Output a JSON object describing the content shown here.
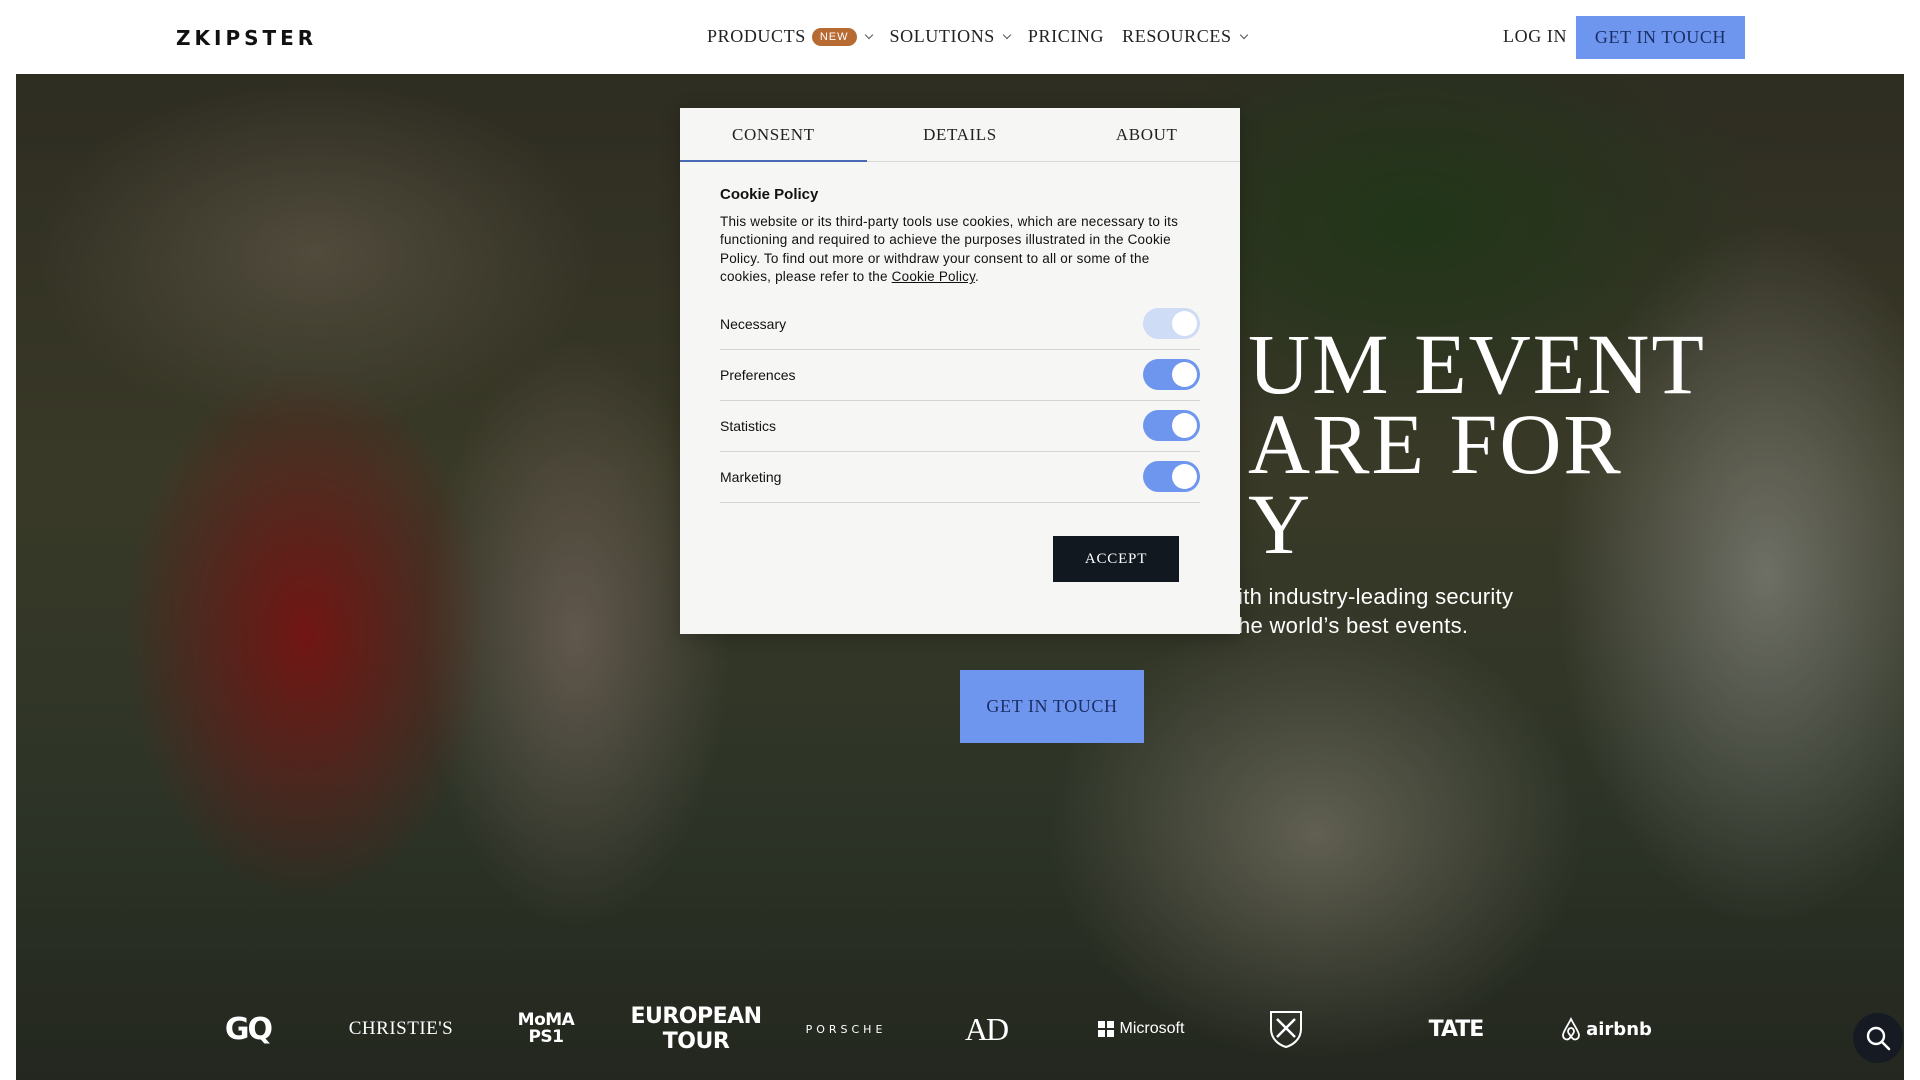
{
  "header": {
    "logo": "ZKIPSTER",
    "nav": [
      {
        "label": "PRODUCTS",
        "badge": "NEW",
        "dropdown": true
      },
      {
        "label": "SOLUTIONS",
        "dropdown": true
      },
      {
        "label": "PRICING",
        "dropdown": false
      },
      {
        "label": "RESOURCES",
        "dropdown": true
      }
    ],
    "login": "LOG IN",
    "cta": "GET IN TOUCH"
  },
  "hero": {
    "headline_lines": [
      "UM EVENT",
      "ARE FOR",
      "Y"
    ],
    "subline_lines": [
      "ith industry-leading security",
      "he world’s best events."
    ],
    "cta": "GET IN TOUCH",
    "brand_logos": [
      "GQ",
      "CHRISTIE'S",
      "MoMA PS1",
      "EUROPEAN TOUR",
      "PORSCHE",
      "AD",
      "Microsoft",
      "crest",
      "TATE",
      "airbnb"
    ]
  },
  "cookie_dialog": {
    "tabs": [
      "CONSENT",
      "DETAILS",
      "ABOUT"
    ],
    "active_tab": "CONSENT",
    "title": "Cookie Policy",
    "text": "This website or its third-party tools use cookies, which are necessary to its functioning and required to achieve the purposes illustrated in the Cookie Policy. To find out more or withdraw your consent to all or some of the cookies, please refer to the ",
    "link": "Cookie Policy",
    "text_end": ".",
    "toggles": [
      {
        "label": "Necessary",
        "enabled": true,
        "locked": true
      },
      {
        "label": "Preferences",
        "enabled": true,
        "locked": false
      },
      {
        "label": "Statistics",
        "enabled": true,
        "locked": false
      },
      {
        "label": "Marketing",
        "enabled": true,
        "locked": false
      }
    ],
    "accept": "ACCEPT"
  },
  "colors": {
    "accent": "#6f96ee",
    "badge": "#b86a33",
    "dark_button": "#111820"
  },
  "icons": {
    "search_fab": "search-icon",
    "nav_dropdown": "chevron-down-icon"
  }
}
